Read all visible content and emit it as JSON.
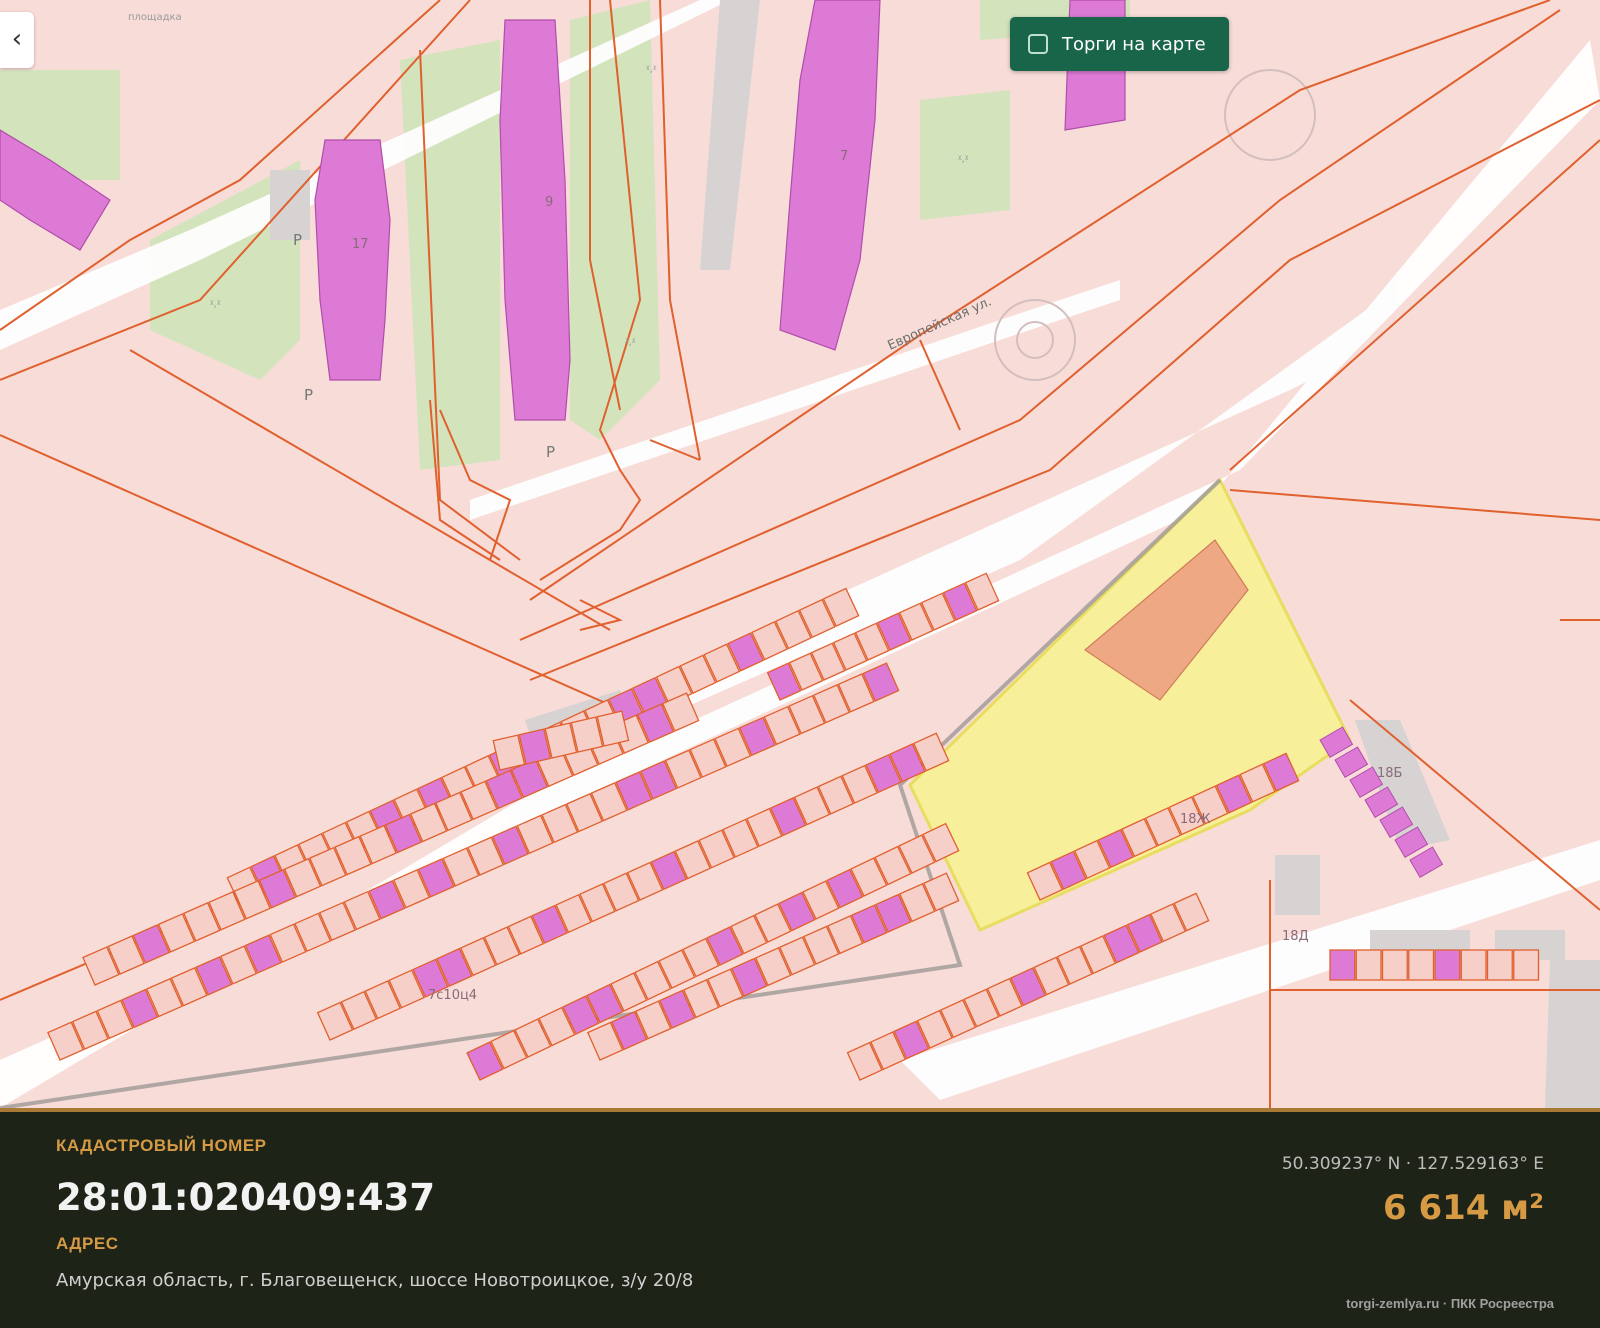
{
  "map": {
    "labels": {
      "playground": "площадка",
      "street": "Европейская ул.",
      "house_17": "17",
      "house_9": "9",
      "house_7": "7",
      "house_18b": "18Б",
      "house_18d": "18Д",
      "garage_block": "7с10ц4",
      "plot_tag": "18Ж",
      "parking": "P",
      "green_mark": "ᵡ,ᵡ"
    },
    "colors": {
      "background": "#f8dcd8",
      "boundary": "#e0602e",
      "building": "#dd7ad6",
      "selected_plot": "#f8ef9a",
      "selected_plot_border": "#e8dd60",
      "green": "#cde5b8",
      "road": "#ffffff"
    }
  },
  "controls": {
    "back_icon": "‹",
    "torgi_label": "Торги на карте"
  },
  "panel": {
    "cadastral_label": "КАДАСТРОВЫЙ НОМЕР",
    "cadastral_number": "28:01:020409:437",
    "address_label": "АДРЕС",
    "address": "Амурская область, г. Благовещенск, шоссе Новотроицкое, з/у 20/8",
    "coordinates": "50.309237° N · 127.529163° E",
    "area": "6 614 м²",
    "source": "torgi-zemlya.ru · ПКК Росреестра"
  }
}
